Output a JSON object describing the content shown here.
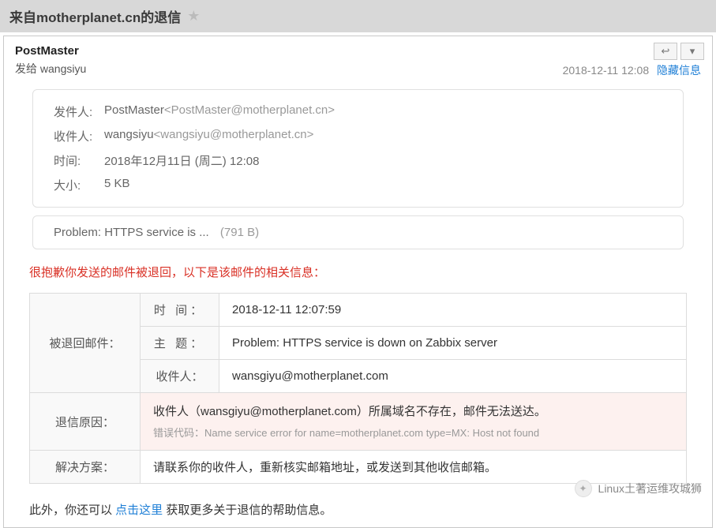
{
  "subject": "来自motherplanet.cn的退信",
  "from_name": "PostMaster",
  "to_prefix": "发给 ",
  "to_name": "wangsiyu",
  "timestamp": "2018-12-11 12:08",
  "hide_link": "隐藏信息",
  "details": {
    "sender_label": "发件人:",
    "sender_name": "PostMaster",
    "sender_email": "<PostMaster@motherplanet.cn>",
    "recipient_label": "收件人:",
    "recipient_name": "wangsiyu",
    "recipient_email": "<wangsiyu@motherplanet.cn>",
    "time_label": "时间:",
    "time_value": "2018年12月11日 (周二) 12:08",
    "size_label": "大小:",
    "size_value": "5 KB"
  },
  "attachment": {
    "name": "Problem: HTTPS service is ...",
    "size": "(791 B)"
  },
  "bounce_header": "很抱歉你发送的邮件被退回，以下是该邮件的相关信息：",
  "table": {
    "returned_label": "被退回邮件：",
    "time_label": "时   间：",
    "time_value": "2018-12-11 12:07:59",
    "subject_label": "主   题：",
    "subject_value": "Problem: HTTPS service is down on Zabbix server",
    "recipient_label": "收件人：",
    "recipient_value": "wansgiyu@motherplanet.com",
    "reason_label": "退信原因：",
    "reason_text": "收件人（wansgiyu@motherplanet.com）所属域名不存在，邮件无法送达。",
    "error_code": "错误代码：Name service error for name=motherplanet.com type=MX: Host not found",
    "solution_label": "解决方案：",
    "solution_text": "请联系你的收件人，重新核实邮箱地址，或发送到其他收信邮箱。"
  },
  "footnote_prefix": "此外，你还可以 ",
  "footnote_link": "点击这里",
  "footnote_suffix": " 获取更多关于退信的帮助信息。",
  "watermark": "Linux土著运维攻城狮"
}
